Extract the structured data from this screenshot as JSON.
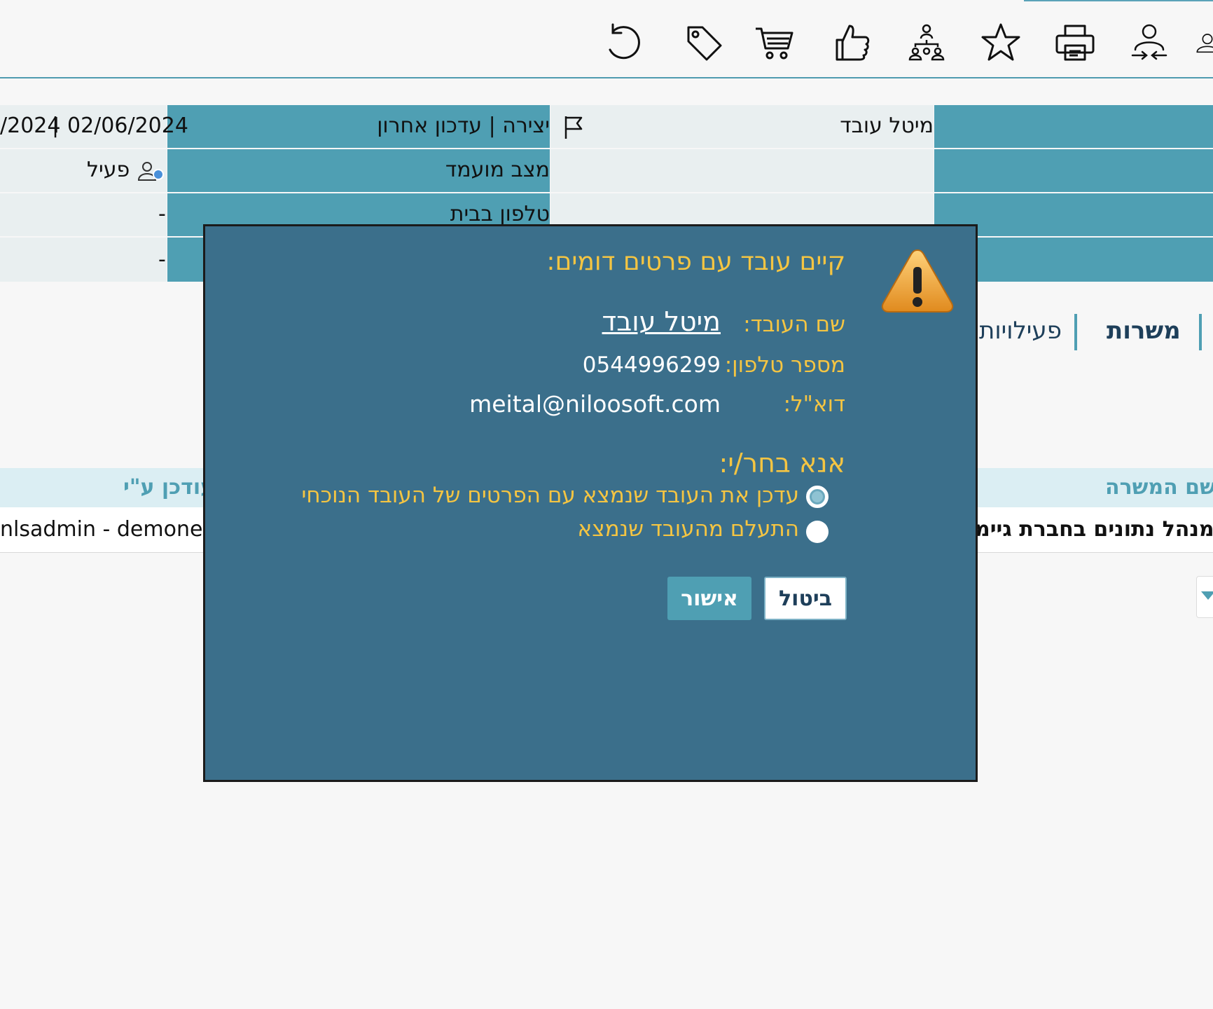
{
  "toolbar": {
    "icons": [
      "refresh-icon",
      "tag-icon",
      "cart-icon",
      "thumbs-up-icon",
      "org-chart-icon",
      "star-icon",
      "printer-icon",
      "user-transfer-icon",
      "user-icon"
    ]
  },
  "details": {
    "row1": {
      "name_value": "מיטל עובד",
      "dates_label": "יצירה | עדכון אחרון",
      "date_created": "02/06/2024",
      "date_updated": "/2024",
      "separator": "|"
    },
    "row2": {
      "status_label": "מצב מועמד",
      "status_value": "פעיל"
    },
    "row3": {
      "home_phone_label": "טלפון בבית",
      "home_phone_value": "-"
    },
    "row4": {
      "value": "-"
    }
  },
  "tabs": {
    "positions": "משרות",
    "activities": "פעילויות"
  },
  "table": {
    "headers": {
      "position_name": "שם המשרה",
      "updated_by": "עודכן ע\"י"
    },
    "row": {
      "position_name": "מנהל נתונים בחברת גיימ",
      "updated_by": "nlsadmin - demonew"
    }
  },
  "modal": {
    "title": "קיים עובד עם פרטים דומים:",
    "name_label": "שם העובד:",
    "name_value": "מיטל עובד",
    "phone_label": "מספר טלפון:",
    "phone_value": "0544996299",
    "email_label": "דוא\"ל:",
    "email_value": "meital@niloosoft.com",
    "choose_label": "אנא בחר/י:",
    "option_update": "עדכן את העובד שנמצא עם הפרטים של העובד הנוכחי",
    "option_ignore": "התעלם מהעובד שנמצא",
    "cancel_label": "ביטול",
    "ok_label": "אישור"
  },
  "colors": {
    "teal": "#4f9fb3",
    "modal_bg": "#3b6f8b",
    "accent_yellow": "#f5c542",
    "dark_navy": "#1e3f5a"
  }
}
